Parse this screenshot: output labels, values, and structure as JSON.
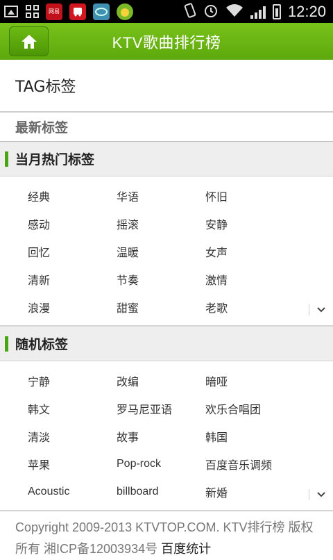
{
  "status_bar": {
    "time": "12:20",
    "apps": [
      {
        "label": "网易",
        "color": "#c0121a"
      },
      {
        "label": "",
        "color": "#d0161f"
      },
      {
        "label": "",
        "color": "#3e8fb0"
      },
      {
        "label": "",
        "color": "#7ab82a"
      }
    ]
  },
  "header": {
    "title": "KTV歌曲排行榜"
  },
  "page": {
    "tag_title": "TAG标签",
    "latest_label": "最新标签"
  },
  "monthly": {
    "title": "当月热门标签",
    "rows": [
      [
        "经典",
        "华语",
        "怀旧"
      ],
      [
        "感动",
        "摇滚",
        "安静"
      ],
      [
        "回忆",
        "温暖",
        "女声"
      ],
      [
        "清新",
        "节奏",
        "激情"
      ],
      [
        "浪漫",
        "甜蜜",
        "老歌"
      ]
    ]
  },
  "random": {
    "title": "随机标签",
    "rows": [
      [
        "宁静",
        "改编",
        "暗哑"
      ],
      [
        "韩文",
        "罗马尼亚语",
        "欢乐合唱团"
      ],
      [
        "清淡",
        "故事",
        "韩国"
      ],
      [
        "苹果",
        "Pop-rock",
        "百度音乐调频"
      ],
      [
        "Acoustic",
        "billboard",
        "新婚"
      ]
    ]
  },
  "footer": {
    "text": "Copyright 2009-2013 KTVTOP.COM. KTV排行榜 版权所有 湘ICP备12003934号",
    "link": "百度统计"
  },
  "colors": {
    "accent_green": "#5da80c",
    "section_bar": "#4aa512"
  }
}
